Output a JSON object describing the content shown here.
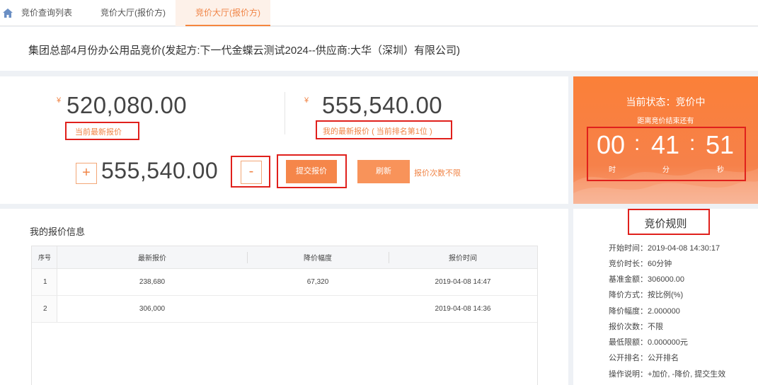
{
  "tabs": [
    {
      "label": "竞价查询列表",
      "active": false
    },
    {
      "label": "竞价大厅(报价方)",
      "active": false
    },
    {
      "label": "竞价大厅(报价方)",
      "active": true
    }
  ],
  "page_title": "集团总部4月份办公用品竞价(发起方:下一代金蝶云测试2024--供应商:大华（深圳）有限公司)",
  "price": {
    "currency": "¥",
    "latest_price": "520,080.00",
    "latest_price_label": "当前最新报价",
    "my_price": "555,540.00",
    "my_price_label": "我的最新报价",
    "my_rank": "( 当前排名第1位 )",
    "plus_label": "+",
    "bid_input": "555,540.00",
    "minus_label": "-",
    "submit_label": "提交报价",
    "refresh_label": "刷新",
    "bid_limit_note": "报价次数不限"
  },
  "timer": {
    "status": "当前状态：竞价中",
    "remaining_label": "距离竞价结束还有",
    "hours": "00",
    "minutes": "41",
    "seconds": "51",
    "sep": ":",
    "hour_unit": "时",
    "minute_unit": "分",
    "second_unit": "秒"
  },
  "info": {
    "title": "我的报价信息",
    "columns": [
      "序号",
      "最新报价",
      "降价幅度",
      "报价时间"
    ],
    "rows": [
      {
        "no": "1",
        "price": "238,680",
        "drop": "67,320",
        "time": "2019-04-08 14:47"
      },
      {
        "no": "2",
        "price": "306,000",
        "drop": "",
        "time": "2019-04-08 14:36"
      }
    ]
  },
  "rules": {
    "title": "竞价规则",
    "items": [
      "开始时间：2019-04-08 14:30:17",
      "竞价时长：60分钟",
      "基准金额：306000.00",
      "降价方式：按比例(%)",
      "降价幅度：2.000000",
      "报价次数：不限",
      "最低限额：0.000000元",
      "公开排名：公开排名",
      "操作说明：+加价, -降价, 提交生效"
    ]
  },
  "colors": {
    "accent": "#f5864a",
    "highlight_box": "#e0201c"
  }
}
